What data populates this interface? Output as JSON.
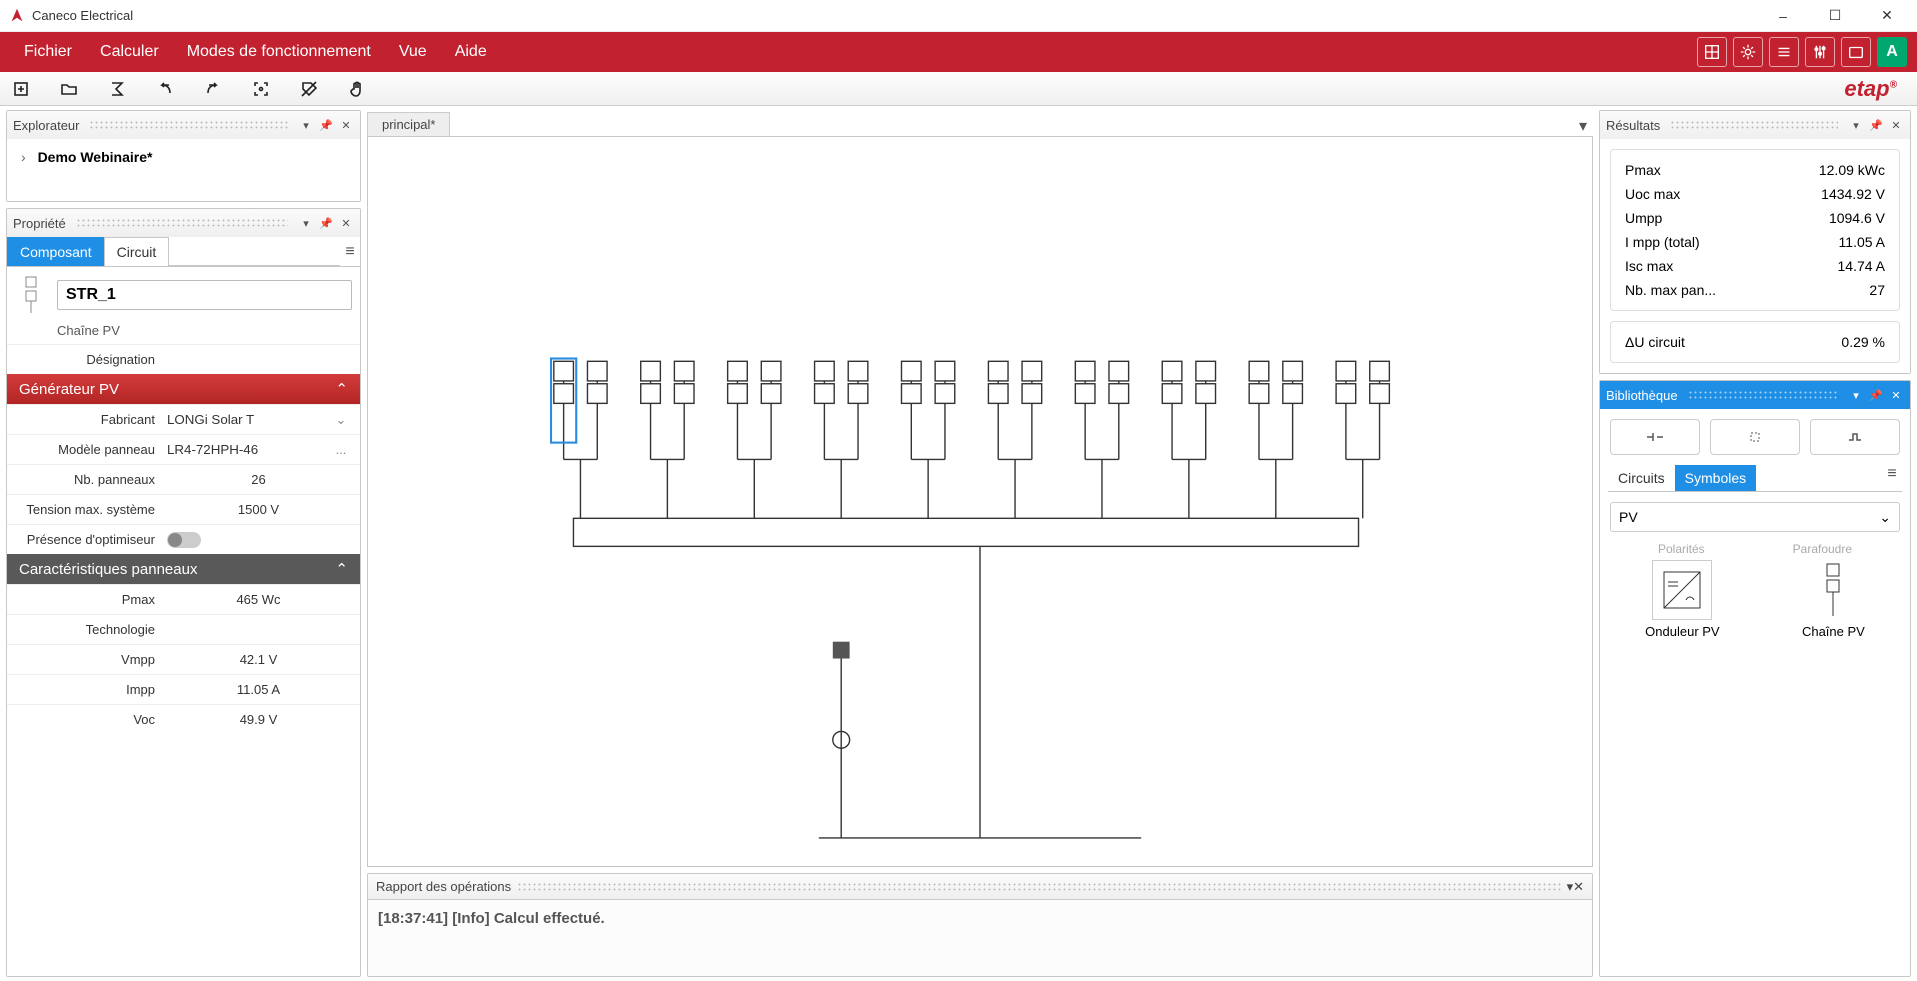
{
  "app_title": "Caneco Electrical",
  "menubar": {
    "items": [
      "Fichier",
      "Calculer",
      "Modes de fonctionnement",
      "Vue",
      "Aide"
    ],
    "avatar_letter": "A"
  },
  "brand": "etap",
  "explorer": {
    "title": "Explorateur",
    "root": "Demo Webinaire*"
  },
  "property": {
    "title": "Propriété",
    "tabs": {
      "composant": "Composant",
      "circuit": "Circuit"
    },
    "component": {
      "name": "STR_1",
      "type": "Chaîne PV"
    },
    "designation_label": "Désignation",
    "section_generator": "Générateur PV",
    "gen": {
      "fabricant_label": "Fabricant",
      "fabricant": "LONGi Solar T",
      "modele_label": "Modèle panneau",
      "modele": "LR4-72HPH-46",
      "nb_label": "Nb. panneaux",
      "nb": "26",
      "tension_label": "Tension max. système",
      "tension": "1500 V",
      "opt_label": "Présence d'optimiseur"
    },
    "section_carac": "Caractéristiques panneaux",
    "carac": {
      "pmax_label": "Pmax",
      "pmax": "465 Wc",
      "tech_label": "Technologie",
      "tech": "",
      "vmpp_label": "Vmpp",
      "vmpp": "42.1 V",
      "impp_label": "Impp",
      "impp": "11.05 A",
      "voc_label": "Voc",
      "voc": "49.9 V"
    }
  },
  "canvas": {
    "tab": "principal*"
  },
  "oplog": {
    "title": "Rapport des opérations",
    "line": "[18:37:41] [Info] Calcul effectué."
  },
  "results": {
    "title": "Résultats",
    "rows": [
      {
        "n": "Pmax",
        "v": "12.09 kWc"
      },
      {
        "n": "Uoc max",
        "v": "1434.92 V"
      },
      {
        "n": "Umpp",
        "v": "1094.6 V"
      },
      {
        "n": "I mpp (total)",
        "v": "11.05 A"
      },
      {
        "n": "Isc max",
        "v": "14.74 A"
      },
      {
        "n": "Nb. max pan...",
        "v": "27"
      }
    ],
    "du": {
      "n": "ΔU circuit",
      "v": "0.29 %"
    }
  },
  "library": {
    "title": "Bibliothèque",
    "tabs": {
      "circuits": "Circuits",
      "symboles": "Symboles"
    },
    "select": "PV",
    "cutoff": {
      "a": "Polarités",
      "b": "Parafoudre"
    },
    "items": {
      "a": "Onduleur PV",
      "b": "Chaîne PV"
    }
  }
}
